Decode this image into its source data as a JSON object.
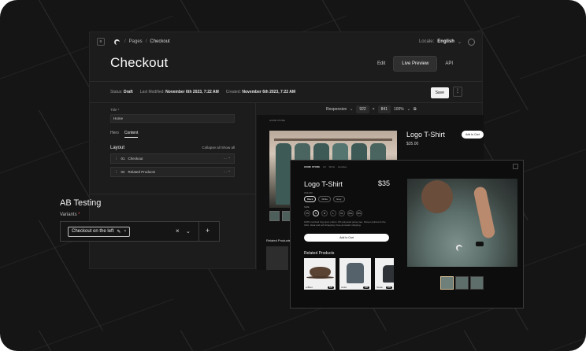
{
  "topbar": {
    "menu_glyph": "≡",
    "breadcrumb": [
      "Pages",
      "Checkout"
    ],
    "locale_label": "Locale:",
    "locale_value": "English"
  },
  "page": {
    "title": "Checkout"
  },
  "tabs": [
    "Edit",
    "Live Preview",
    "API"
  ],
  "status": {
    "status_label": "Status:",
    "status_value": "Draft",
    "modified_label": "Last Modified:",
    "modified_value": "November 6th 2023, 7:22 AM",
    "created_label": "Created:",
    "created_value": "November 6th 2023, 7:22 AM",
    "save": "Save",
    "more": "⋮"
  },
  "form": {
    "title_label": "Title *",
    "title_value": "Home",
    "subtabs": [
      "Hero",
      "Content"
    ],
    "layout_heading": "Layout",
    "collapse_all": "Collapse all",
    "show_all": "Show all",
    "blocks": [
      {
        "num": "01",
        "name": "Checkout"
      },
      {
        "num": "02",
        "name": "Related Products"
      }
    ]
  },
  "preview": {
    "mode": "Responsive",
    "width": "922",
    "times": "×",
    "height": "841",
    "zoom": "100%"
  },
  "shop_back": {
    "nav": "HOME STORE",
    "title": "Logo T-Shirt",
    "price": "$35.00",
    "add_to_cart": "Add to Cart",
    "related": "Related Products"
  },
  "store": {
    "nav": [
      "HOME STORE",
      "All",
      "Shirts",
      "Hoodies"
    ],
    "title": "Logo T-Shirt",
    "price": "$35",
    "color_label": "COLOR",
    "colors": [
      "Black",
      "White",
      "Grey"
    ],
    "size_label": "SIZE",
    "sizes": [
      "XS",
      "S",
      "M",
      "L",
      "XL",
      "2XL",
      "3XL"
    ],
    "description": "100% combed ring spun cotton. 6% polyester jersey tee. Screen printed in the USA. Ideal and soft shopping. Free domestic shipping.",
    "add_to_cart": "Add to Cart",
    "related_heading": "Related Products",
    "related": [
      {
        "name": "LeBlanc",
        "price": "$35"
      },
      {
        "name": "Jacket",
        "price": "$35"
      },
      {
        "name": "Hoodie",
        "price": "$35"
      }
    ]
  },
  "ab_testing": {
    "title": "AB Testing",
    "variants_label": "Variants",
    "required_mark": "*",
    "chip_label": "Checkout on the left",
    "chip_edit": "✎",
    "chip_remove": "×",
    "clear": "×",
    "caret": "⌄",
    "add": "+"
  },
  "colors": {
    "background": "#151515",
    "panel": "#1c1c1c",
    "accent": "#f3f3f3"
  }
}
